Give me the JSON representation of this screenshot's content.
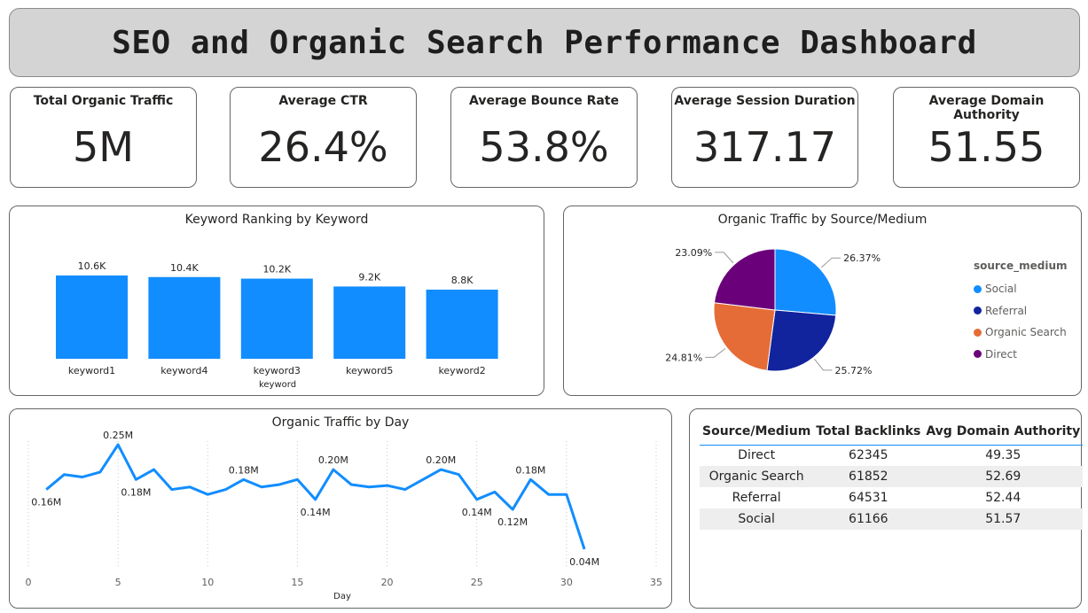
{
  "dashboard": {
    "title": "SEO and Organic Search Performance Dashboard"
  },
  "kpis": [
    {
      "label": "Total Organic Traffic",
      "value": "5M"
    },
    {
      "label": "Average CTR",
      "value": "26.4%"
    },
    {
      "label": "Average Bounce Rate",
      "value": "53.8%"
    },
    {
      "label": "Average Session Duration",
      "value": "317.17"
    },
    {
      "label": "Average Domain Authority",
      "value": "51.55"
    }
  ],
  "chart_data": [
    {
      "type": "bar",
      "title": "Keyword Ranking by Keyword",
      "xlabel": "keyword",
      "ylabel": "",
      "categories": [
        "keyword1",
        "keyword4",
        "keyword3",
        "keyword5",
        "keyword2"
      ],
      "values": [
        10600,
        10400,
        10200,
        9200,
        8800
      ],
      "data_labels": [
        "10.6K",
        "10.4K",
        "10.2K",
        "9.2K",
        "8.8K"
      ],
      "ylim": [
        0,
        10600
      ],
      "color": "#118dff"
    },
    {
      "type": "pie",
      "title": "Organic Traffic by Source/Medium",
      "legend_title": "source_medium",
      "legend_position": "right",
      "slices": [
        {
          "label": "Social",
          "value": 26.37,
          "value_label": "26.37%",
          "color": "#118dff"
        },
        {
          "label": "Referral",
          "value": 25.72,
          "value_label": "25.72%",
          "color": "#12239e"
        },
        {
          "label": "Organic Search",
          "value": 24.81,
          "value_label": "24.81%",
          "color": "#e66c37"
        },
        {
          "label": "Direct",
          "value": 23.09,
          "value_label": "23.09%",
          "color": "#6b007b"
        }
      ]
    },
    {
      "type": "line",
      "title": "Organic Traffic by Day",
      "xlabel": "Day",
      "ylabel": "",
      "xlim": [
        0,
        35
      ],
      "ylim": [
        0.04,
        0.25
      ],
      "x_ticks": [
        0,
        5,
        10,
        15,
        20,
        25,
        30,
        35
      ],
      "grid": "vertical dotted",
      "color": "#118dff",
      "series": [
        {
          "x": [
            1,
            2,
            3,
            4,
            5,
            6,
            7,
            8,
            9,
            10,
            11,
            12,
            13,
            14,
            15,
            16,
            17,
            18,
            19,
            20,
            21,
            22,
            23,
            24,
            25,
            26,
            27,
            28,
            29,
            30,
            31
          ],
          "y": [
            0.16,
            0.19,
            0.185,
            0.195,
            0.25,
            0.18,
            0.2,
            0.16,
            0.165,
            0.15,
            0.16,
            0.18,
            0.165,
            0.17,
            0.18,
            0.14,
            0.2,
            0.17,
            0.165,
            0.168,
            0.16,
            0.18,
            0.2,
            0.19,
            0.14,
            0.155,
            0.12,
            0.18,
            0.15,
            0.15,
            0.04
          ]
        }
      ],
      "data_labels": [
        {
          "x": 1,
          "text": "0.16M"
        },
        {
          "x": 5,
          "text": "0.25M"
        },
        {
          "x": 6,
          "text": "0.18M"
        },
        {
          "x": 12,
          "text": "0.18M"
        },
        {
          "x": 16,
          "text": "0.14M"
        },
        {
          "x": 17,
          "text": "0.20M"
        },
        {
          "x": 23,
          "text": "0.20M"
        },
        {
          "x": 25,
          "text": "0.14M"
        },
        {
          "x": 27,
          "text": "0.12M"
        },
        {
          "x": 28,
          "text": "0.18M"
        },
        {
          "x": 31,
          "text": "0.04M"
        }
      ]
    },
    {
      "type": "table",
      "columns": [
        "Source/Medium",
        "Total Backlinks",
        "Avg Domain Authority"
      ],
      "rows": [
        [
          "Direct",
          "62345",
          "49.35"
        ],
        [
          "Organic Search",
          "61852",
          "52.69"
        ],
        [
          "Referral",
          "64531",
          "52.44"
        ],
        [
          "Social",
          "61166",
          "51.57"
        ]
      ]
    }
  ]
}
